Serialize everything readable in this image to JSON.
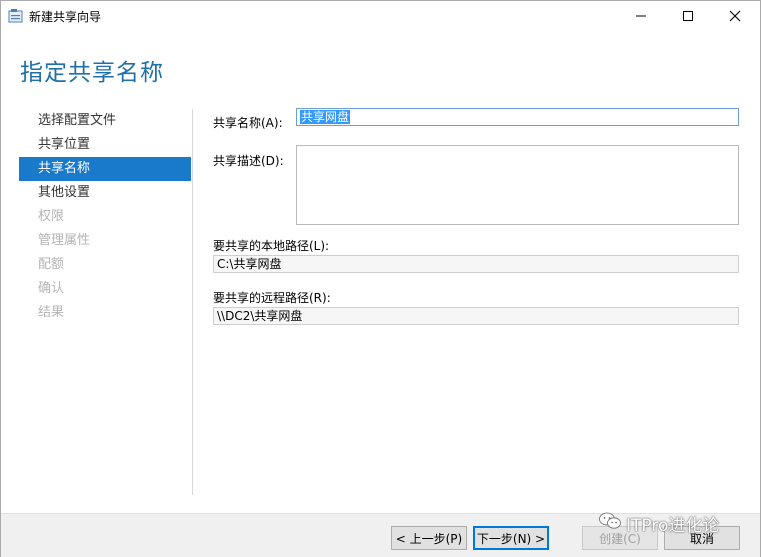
{
  "window": {
    "title": "新建共享向导"
  },
  "wizard": {
    "page_title": "指定共享名称"
  },
  "nav": {
    "items": [
      {
        "label": "选择配置文件",
        "state": "normal"
      },
      {
        "label": "共享位置",
        "state": "normal"
      },
      {
        "label": "共享名称",
        "state": "active"
      },
      {
        "label": "其他设置",
        "state": "normal"
      },
      {
        "label": "权限",
        "state": "disabled"
      },
      {
        "label": "管理属性",
        "state": "disabled"
      },
      {
        "label": "配额",
        "state": "disabled"
      },
      {
        "label": "确认",
        "state": "disabled"
      },
      {
        "label": "结果",
        "state": "disabled"
      }
    ]
  },
  "form": {
    "share_name_label": "共享名称(A):",
    "share_name_value": "共享网盘",
    "share_desc_label": "共享描述(D):",
    "share_desc_value": "",
    "local_path_label": "要共享的本地路径(L):",
    "local_path_value": "C:\\共享网盘",
    "remote_path_label": "要共享的远程路径(R):",
    "remote_path_value": "\\\\DC2\\共享网盘"
  },
  "buttons": {
    "prev": "< 上一步(P)",
    "next": "下一步(N) >",
    "create": "创建(C)",
    "cancel": "取消"
  },
  "watermark": {
    "text": "ITPro进化论"
  },
  "colors": {
    "accent": "#1979ca",
    "title": "#1f6fa8"
  }
}
